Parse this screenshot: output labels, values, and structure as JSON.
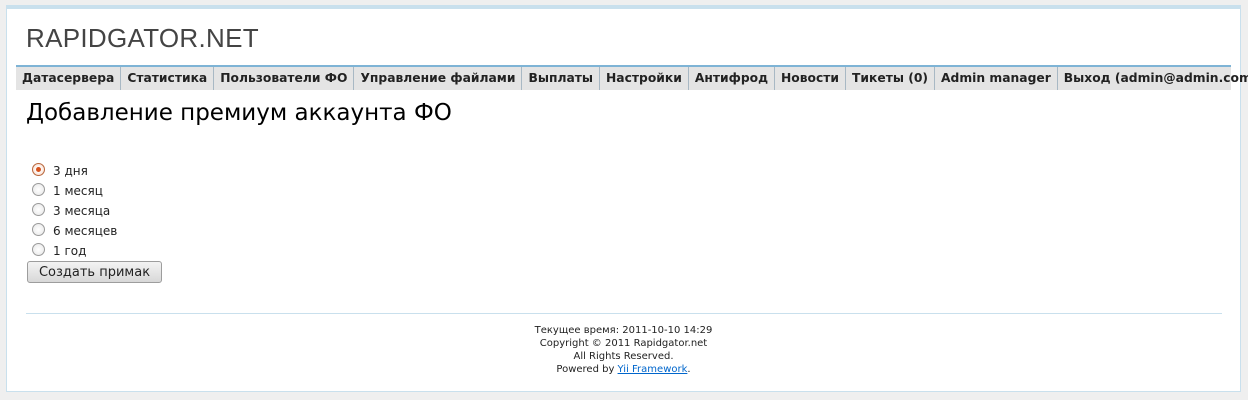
{
  "site": {
    "logo": "RAPIDGATOR.NET"
  },
  "menu": {
    "items": [
      "Датасервера",
      "Статистика",
      "Пользователи ФО",
      "Управление файлами",
      "Выплаты",
      "Настройки",
      "Антифрод",
      "Новости",
      "Тикеты (0)",
      "Admin manager",
      "Выход (admin@admin.com)"
    ]
  },
  "main": {
    "title": "Добавление премиум аккаунта ФО",
    "options": [
      {
        "label": "3 дня",
        "checked": true
      },
      {
        "label": "1 месяц",
        "checked": false
      },
      {
        "label": "3 месяца",
        "checked": false
      },
      {
        "label": "6 месяцев",
        "checked": false
      },
      {
        "label": "1 год",
        "checked": false
      }
    ],
    "submit_label": "Создать примак"
  },
  "footer": {
    "time_line": "Текущее время: 2011-10-10 14:29",
    "copyright": "Copyright © 2011 Rapidgator.net",
    "rights": "All Rights Reserved.",
    "powered_prefix": "Powered by ",
    "powered_link": "Yii Framework",
    "powered_suffix": "."
  },
  "colors": {
    "menu_bar": "#7fb4d6",
    "menu_bg": "#e4e4e4",
    "link": "#0066cc",
    "radio_checked": "#d8521c"
  }
}
